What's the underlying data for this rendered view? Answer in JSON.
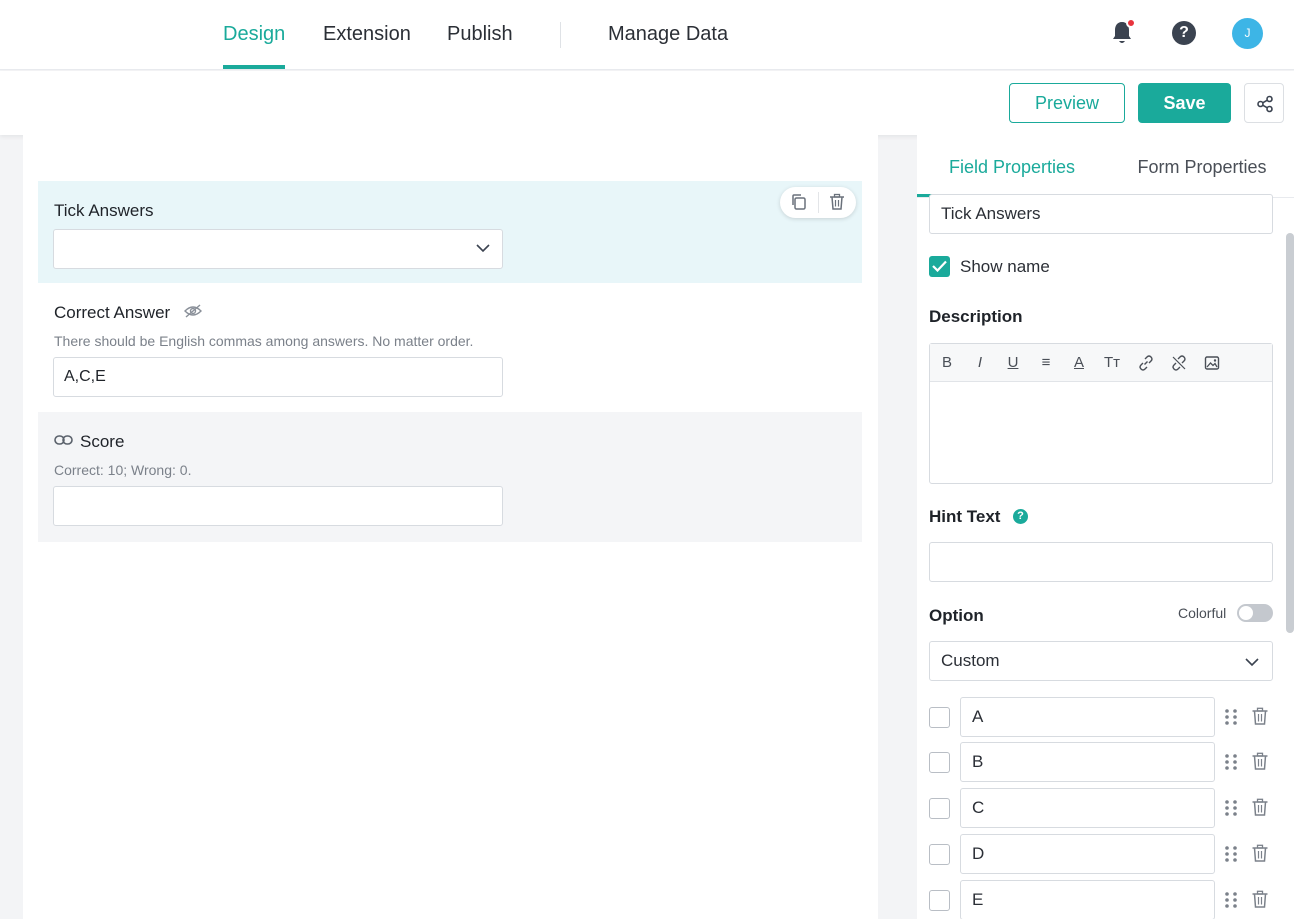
{
  "nav": {
    "tabs": [
      {
        "label": "Design",
        "active": true
      },
      {
        "label": "Extension",
        "active": false
      },
      {
        "label": "Publish",
        "active": false
      },
      {
        "label": "Manage Data",
        "active": false
      }
    ],
    "avatar_initial": "J",
    "notification_dot": true
  },
  "toolbar": {
    "preview_label": "Preview",
    "save_label": "Save"
  },
  "canvas": {
    "tick_field": {
      "label": "Tick Answers",
      "value": ""
    },
    "correct_answer": {
      "label": "Correct Answer",
      "hint": "There should be English commas among answers. No matter order.",
      "value": "A,C,E"
    },
    "score": {
      "label": "Score",
      "hint": "Correct: 10; Wrong: 0.",
      "value": ""
    }
  },
  "panel": {
    "tabs": [
      {
        "label": "Field Properties",
        "active": true
      },
      {
        "label": "Form Properties",
        "active": false
      }
    ],
    "name_value": "Tick Answers",
    "show_name_label": "Show name",
    "show_name_checked": true,
    "description_label": "Description",
    "rte_buttons": [
      "B",
      "I",
      "U",
      "≡",
      "A",
      "Tт"
    ],
    "hint_text_label": "Hint Text",
    "hint_text_value": "",
    "option_label": "Option",
    "colorful_label": "Colorful",
    "colorful_on": false,
    "option_source": "Custom",
    "options": [
      {
        "label": "A",
        "checked": false
      },
      {
        "label": "B",
        "checked": false
      },
      {
        "label": "C",
        "checked": false
      },
      {
        "label": "D",
        "checked": false
      },
      {
        "label": "E",
        "checked": false
      }
    ]
  },
  "colors": {
    "accent": "#1aaa9b",
    "selected_block_bg": "#e8f6f9",
    "notification": "#e8343d",
    "avatar": "#3db5e6"
  }
}
